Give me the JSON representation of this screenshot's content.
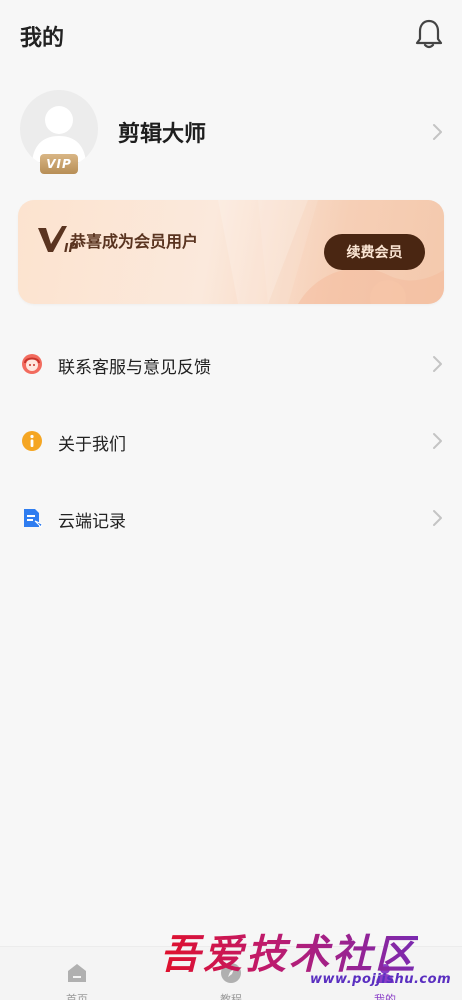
{
  "header": {
    "title": "我的",
    "bell_icon": "bell-icon"
  },
  "profile": {
    "username": "剪辑大师",
    "vip_tag": "VIP",
    "avatar_icon": "avatar-placeholder-icon"
  },
  "vip_card": {
    "message": "恭喜成为会员用户",
    "logo_text": "VIP",
    "renew_label": "续费会员"
  },
  "menu": {
    "items": [
      {
        "label": "联系客服与意见反馈",
        "icon": "customer-service-icon",
        "color": "#e94a4a"
      },
      {
        "label": "关于我们",
        "icon": "info-icon",
        "color": "#f0a020"
      },
      {
        "label": "云端记录",
        "icon": "cloud-record-icon",
        "color": "#2f7df0"
      }
    ]
  },
  "bottom_nav": {
    "items": [
      {
        "label": "首页",
        "icon": "home-icon"
      },
      {
        "label": "教程",
        "icon": "compass-icon"
      },
      {
        "label": "我的",
        "icon": "profile-icon"
      }
    ],
    "active_color": "#8a3fc7"
  },
  "watermark": {
    "text": "吾爱技术社区",
    "url": "www.pojjishu.com"
  },
  "colors": {
    "accent_brown": "#4a2612",
    "vip_gold": "#c9a06a",
    "background": "#f7f7f7"
  }
}
